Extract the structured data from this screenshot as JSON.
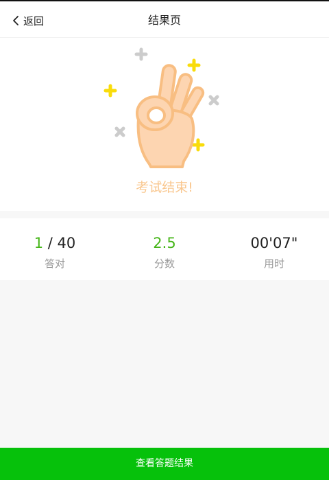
{
  "header": {
    "back_label": "返回",
    "title": "结果页"
  },
  "hero": {
    "message": "考试结束!",
    "colors": {
      "hand_fill": "#fdd5b1",
      "hand_stroke": "#f8be82",
      "sparkle_yellow": "#f9dc0b",
      "sparkle_gray": "#cccccc"
    }
  },
  "stats": {
    "correct": {
      "count": "1",
      "total": " / 40",
      "label": "答对"
    },
    "score": {
      "value": "2.5",
      "label": "分数"
    },
    "time": {
      "value": "00'07\"",
      "label": "用时"
    }
  },
  "colors": {
    "accent_green": "#44b517",
    "button_green": "#06c10b"
  },
  "actions": {
    "view_results_label": "查看答题结果"
  }
}
